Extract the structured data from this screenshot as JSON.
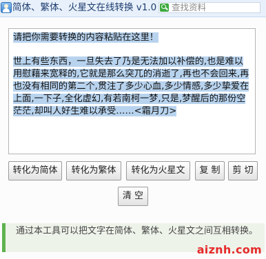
{
  "header": {
    "title": "简体、繁体、火星文在线转换 v1.0",
    "search": {
      "placeholder": "查找资料"
    }
  },
  "editor": {
    "prompt": "请把你需要转换的内容粘贴在这里！",
    "body": "世上有些东西，一旦失去了乃是无法加以补偿的,也是难以用慰藉来宽释的,它就是那么突兀的消逝了,再也不会回来,再也没有相同的第二个,贯注了多少心血,多少情感,多少挚爱在上面,一下子,全化虚幻,有若南柯一梦,只是,梦醒后的那份空茫茫,却叫人好生难以承受……<霜月刀>"
  },
  "buttons": {
    "to_simplified": "转化为简体",
    "to_traditional": "转化为繁体",
    "to_martian": "转化为火星文",
    "copy": "复 制",
    "cut": "剪 切",
    "clear": "清 空"
  },
  "tip": {
    "text": "通过本工具可以把文字在简体、繁体、火星文之间互相转换。"
  },
  "watermark": "aiznh.com",
  "colors": {
    "selection": "#b8d3ee",
    "tip_accent": "#5fb24e",
    "watermark": "#e62b2b"
  }
}
